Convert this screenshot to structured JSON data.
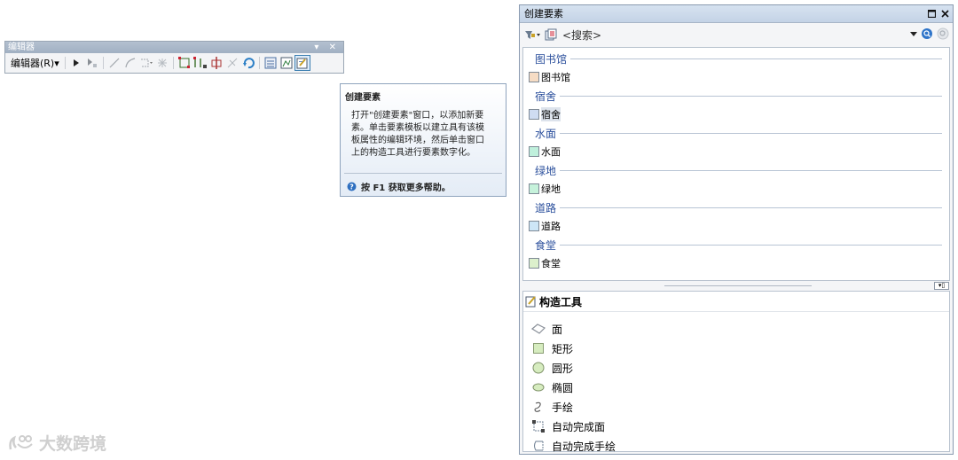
{
  "editor_toolbar": {
    "title": "编辑器",
    "controls": "▾ ✕",
    "menu_label": "编辑器(R)▾"
  },
  "tooltip": {
    "title": "创建要素",
    "body_lines": [
      "打开\"创建要素\"窗口，以添加新要",
      "素。单击要素模板以建立具有该模",
      "板属性的编辑环境，然后单击窗口",
      "上的构造工具进行要素数字化。"
    ],
    "help_text": "按 F1 获取更多帮助。"
  },
  "create_features": {
    "title": "创建要素",
    "search_placeholder": "<搜索>",
    "groups": [
      {
        "header": "图书馆",
        "item": "图书馆",
        "color": "#f6dcc4"
      },
      {
        "header": "宿舍",
        "item": "宿舍",
        "color": "#cfdcf2"
      },
      {
        "header": "水面",
        "item": "水面",
        "color": "#bff0dc"
      },
      {
        "header": "绿地",
        "item": "绿地",
        "color": "#c6f2db"
      },
      {
        "header": "道路",
        "item": "道路",
        "color": "#cde6f7"
      },
      {
        "header": "食堂",
        "item": "食堂",
        "color": "#dcf0cc"
      }
    ],
    "construction_tools": {
      "header": "构造工具",
      "items": [
        "面",
        "矩形",
        "圆形",
        "椭圆",
        "手绘",
        "自动完成面",
        "自动完成手绘"
      ]
    }
  },
  "watermark": {
    "text": "大数跨境"
  }
}
